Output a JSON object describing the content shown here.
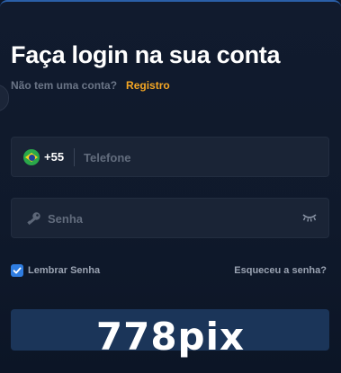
{
  "header": {
    "title": "Faça login na sua conta",
    "no_account_text": "Não tem uma conta?",
    "register_link": "Registro"
  },
  "phone_field": {
    "flag_icon": "brazil-flag-icon",
    "dial_code": "+55",
    "placeholder": "Telefone",
    "value": ""
  },
  "password_field": {
    "lead_icon": "key-icon",
    "placeholder": "Senha",
    "value": "",
    "toggle_icon": "eye-closed-icon"
  },
  "remember": {
    "label": "Lembrar Senha",
    "checked": true
  },
  "forgot_link": "Esqueceu a senha?",
  "watermark": "778pix",
  "colors": {
    "background": "#0d1628",
    "field_bg": "#1a2436",
    "accent_link": "#f5a623",
    "checkbox": "#2f7de1",
    "button_bg": "#1b3559",
    "top_border": "#2a5fa8"
  }
}
